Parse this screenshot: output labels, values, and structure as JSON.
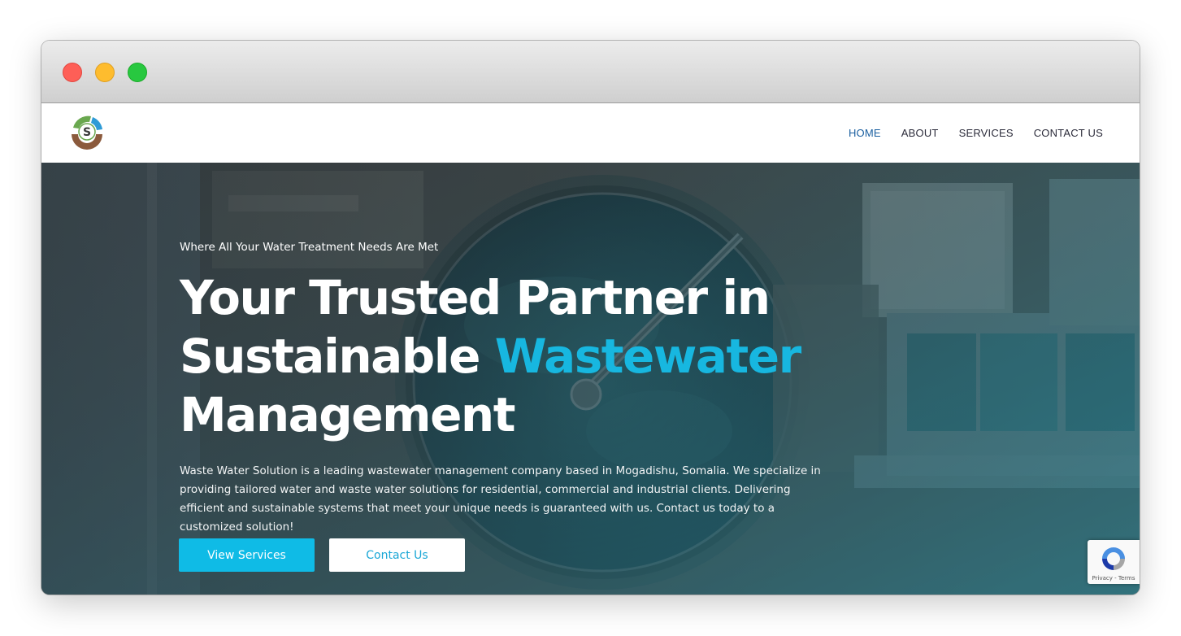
{
  "window": {
    "controls": [
      "close",
      "minimize",
      "maximize"
    ]
  },
  "header": {
    "logo_icon": "ss-droplet-logo-icon",
    "nav": [
      {
        "label": "HOME",
        "active": true
      },
      {
        "label": "ABOUT",
        "active": false
      },
      {
        "label": "SERVICES",
        "active": false
      },
      {
        "label": "CONTACT US",
        "active": false
      }
    ]
  },
  "hero": {
    "tagline": "Where All Your Water Treatment Needs Are Met",
    "title_line1": "Your Trusted Partner in",
    "title_line2_plain": "Sustainable ",
    "title_line2_accent": "Wastewater",
    "title_line3": "Management",
    "description": "Waste Water Solution is a leading wastewater management company based in Mogadishu, Somalia. We specialize in providing tailored water and waste water solutions for residential, commercial and industrial clients. Delivering efficient and sustainable systems that meet your unique needs is guaranteed with us. Contact us today to a customized solution!",
    "primary_button": "View Services",
    "secondary_button": "Contact Us"
  },
  "recaptcha": {
    "label": "Privacy - Terms",
    "icon": "recaptcha-icon"
  },
  "colors": {
    "accent": "#17b7e0",
    "button_primary": "#0fbbe6",
    "nav_active": "#1a5fa0",
    "nav_text": "#2b2b3a"
  }
}
